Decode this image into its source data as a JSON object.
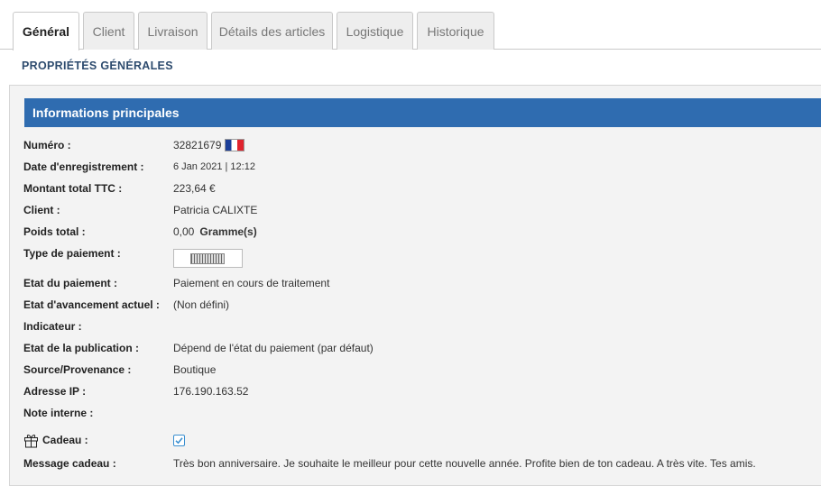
{
  "tabs": [
    {
      "label": "Général",
      "active": true
    },
    {
      "label": "Client",
      "active": false
    },
    {
      "label": "Livraison",
      "active": false
    },
    {
      "label": "Détails des articles",
      "active": false
    },
    {
      "label": "Logistique",
      "active": false
    },
    {
      "label": "Historique",
      "active": false
    }
  ],
  "section_title": "PROPRIÉTÉS GÉNÉRALES",
  "panel_title": "Informations principales",
  "fields": {
    "numero": {
      "label": "Numéro :",
      "value": "32821679"
    },
    "date": {
      "label": "Date d'enregistrement :",
      "value": "6 Jan 2021 | 12:12"
    },
    "montant": {
      "label": "Montant total TTC :",
      "value": "223,64 €"
    },
    "client": {
      "label": "Client :",
      "value": "Patricia CALIXTE"
    },
    "poids": {
      "label": "Poids total :",
      "value": "0,00",
      "unit": "Gramme(s)"
    },
    "type_paiement": {
      "label": "Type de paiement :"
    },
    "etat_paiement": {
      "label": "Etat du paiement :",
      "value": "Paiement en cours de traitement"
    },
    "etat_avancement": {
      "label": "Etat d'avancement actuel :",
      "value": "(Non défini)"
    },
    "indicateur": {
      "label": "Indicateur :",
      "value": ""
    },
    "etat_publication": {
      "label": "Etat de la publication :",
      "value": "Dépend de l'état du paiement (par défaut)"
    },
    "source": {
      "label": "Source/Provenance :",
      "value": "Boutique"
    },
    "ip": {
      "label": "Adresse IP :",
      "value": "176.190.163.52"
    },
    "note": {
      "label": "Note interne :",
      "value": ""
    },
    "cadeau": {
      "label": "Cadeau :",
      "checked": true
    },
    "message": {
      "label": "Message cadeau :",
      "value": "Très bon anniversaire. Je souhaite le meilleur pour cette nouvelle année. Profite bien de ton cadeau. A très vite. Tes amis."
    }
  },
  "colors": {
    "header_bg": "#2f6cb0",
    "section_title": "#2d4b6e",
    "checkbox": "#3a8fd0"
  },
  "icons": {
    "flag": "france-flag-icon",
    "gift": "gift-icon",
    "check": "checkmark-icon"
  }
}
